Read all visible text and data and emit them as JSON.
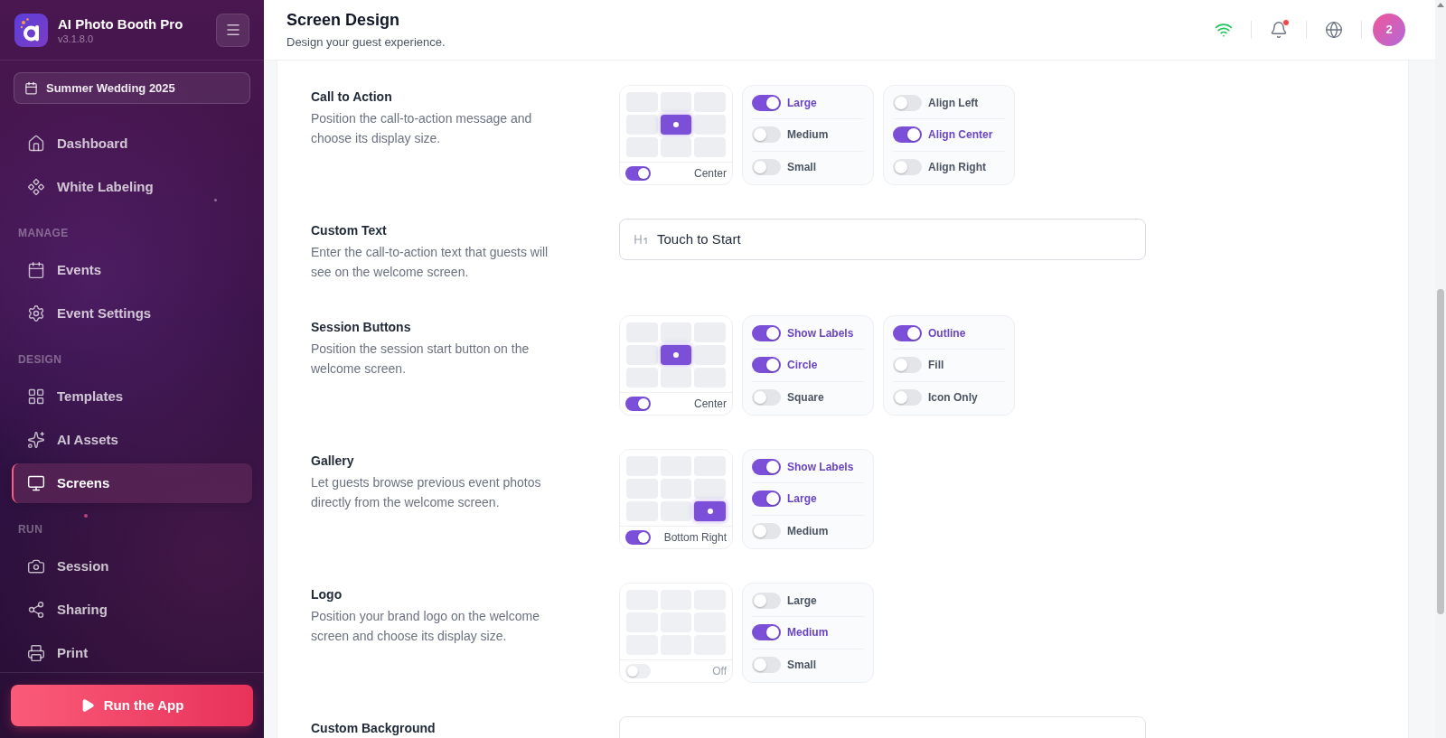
{
  "sidebar": {
    "app_name": "AI Photo Booth Pro",
    "version": "v3.1.8.0",
    "event": "Summer Wedding 2025",
    "sections": [
      {
        "items": [
          {
            "label": "Dashboard",
            "selected": false
          },
          {
            "label": "White Labeling",
            "selected": false
          }
        ]
      },
      {
        "heading": "MANAGE",
        "items": [
          {
            "label": "Events",
            "selected": false
          },
          {
            "label": "Event Settings",
            "selected": false
          }
        ]
      },
      {
        "heading": "DESIGN",
        "items": [
          {
            "label": "Templates",
            "selected": false
          },
          {
            "label": "AI Assets",
            "selected": false
          },
          {
            "label": "Screens",
            "selected": true
          }
        ]
      },
      {
        "heading": "RUN",
        "items": [
          {
            "label": "Session",
            "selected": false
          },
          {
            "label": "Sharing",
            "selected": false
          },
          {
            "label": "Print",
            "selected": false
          }
        ]
      }
    ],
    "run_button": "Run the App"
  },
  "header": {
    "title": "Screen Design",
    "subtitle": "Design your guest experience.",
    "unread_notifications": true,
    "avatar": "2"
  },
  "settings": [
    {
      "kind": "layout",
      "title": "Call to Action",
      "description": "Position the call-to-action message and choose its display size.",
      "position": {
        "enabled": true,
        "label": "Center",
        "cells": [
          {
            "selected": false
          },
          {
            "selected": false
          },
          {
            "selected": false
          },
          {
            "selected": false
          },
          {
            "selected": true
          },
          {
            "selected": false
          },
          {
            "selected": false
          },
          {
            "selected": false
          },
          {
            "selected": false
          }
        ]
      },
      "option_groups": [
        [
          {
            "label": "Large",
            "on": true
          },
          {
            "label": "Medium",
            "on": false
          },
          {
            "label": "Small",
            "on": false
          }
        ],
        [
          {
            "label": "Align Left",
            "on": false
          },
          {
            "label": "Align Center",
            "on": true
          },
          {
            "label": "Align Right",
            "on": false
          }
        ]
      ]
    },
    {
      "kind": "text",
      "title": "Custom Text",
      "description": "Enter the call-to-action text that guests will see on the welcome screen.",
      "value": "Touch to Start"
    },
    {
      "kind": "layout",
      "title": "Session Buttons",
      "description": "Position the session start button on the welcome screen.",
      "position": {
        "enabled": true,
        "label": "Center",
        "cells": [
          {
            "selected": false
          },
          {
            "selected": false
          },
          {
            "selected": false
          },
          {
            "selected": false
          },
          {
            "selected": true
          },
          {
            "selected": false
          },
          {
            "selected": false
          },
          {
            "selected": false
          },
          {
            "selected": false
          }
        ]
      },
      "option_groups": [
        [
          {
            "label": "Show Labels",
            "on": true
          },
          {
            "label": "Circle",
            "on": true
          },
          {
            "label": "Square",
            "on": false
          }
        ],
        [
          {
            "label": "Outline",
            "on": true
          },
          {
            "label": "Fill",
            "on": false
          },
          {
            "label": "Icon Only",
            "on": false
          }
        ]
      ]
    },
    {
      "kind": "layout",
      "title": "Gallery",
      "description": "Let guests browse previous event photos directly from the welcome screen.",
      "position": {
        "enabled": true,
        "label": "Bottom Right",
        "cells": [
          {
            "selected": false
          },
          {
            "selected": false
          },
          {
            "selected": false
          },
          {
            "selected": false
          },
          {
            "selected": false
          },
          {
            "selected": false
          },
          {
            "selected": false
          },
          {
            "selected": false
          },
          {
            "selected": true
          }
        ]
      },
      "option_groups": [
        [
          {
            "label": "Show Labels",
            "on": true
          },
          {
            "label": "Large",
            "on": true
          },
          {
            "label": "Medium",
            "on": false
          }
        ]
      ]
    },
    {
      "kind": "layout",
      "title": "Logo",
      "description": "Position your brand logo on the welcome screen and choose its display size.",
      "position": {
        "enabled": false,
        "label": "Off",
        "cells": [
          {
            "selected": false
          },
          {
            "selected": false
          },
          {
            "selected": false
          },
          {
            "selected": false
          },
          {
            "selected": false
          },
          {
            "selected": false
          },
          {
            "selected": false
          },
          {
            "selected": false
          },
          {
            "selected": false
          }
        ]
      },
      "option_groups": [
        [
          {
            "label": "Large",
            "on": false
          },
          {
            "label": "Medium",
            "on": true
          },
          {
            "label": "Small",
            "on": false
          }
        ]
      ]
    },
    {
      "kind": "field",
      "title": "Custom Background"
    }
  ]
}
